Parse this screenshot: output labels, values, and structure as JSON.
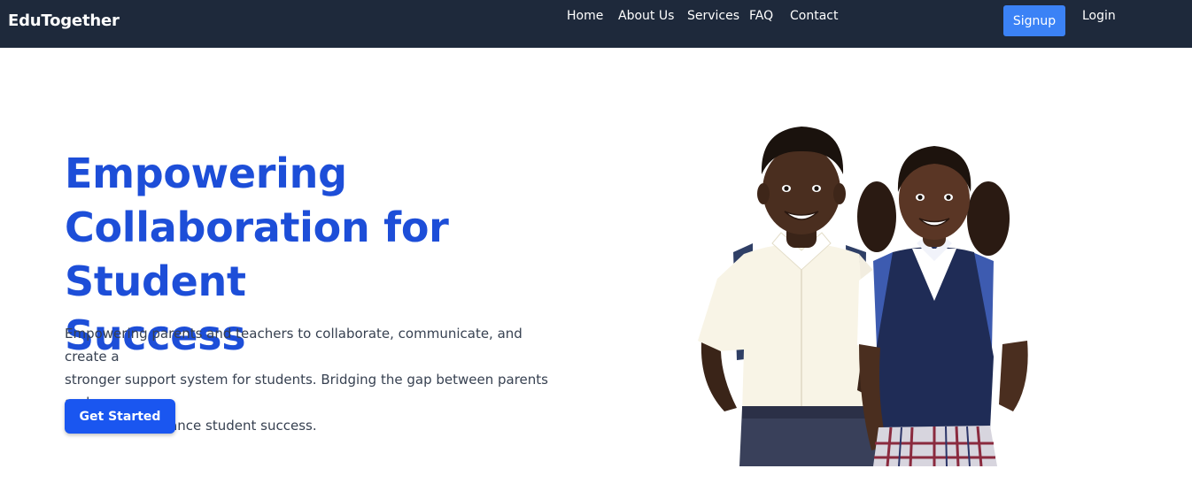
{
  "nav": {
    "brand": "EduTogether",
    "links": [
      "Home",
      "About Us",
      "Services",
      "FAQ",
      "Contact"
    ],
    "signup": "Signup",
    "login": "Login"
  },
  "hero": {
    "title_lines": [
      "Empowering",
      "Collaboration for Student",
      "Success"
    ],
    "description_lines": [
      "Empowering parents and teachers to collaborate, communicate, and create a",
      "stronger support system for students. Bridging the gap between parents and",
      "teachers to enhance student success."
    ],
    "cta": "Get Started"
  },
  "colors": {
    "nav_bg": "#1e293b",
    "title": "#1d4ed8",
    "signup_bg": "#3b82f6",
    "cta_bg": "#1a56f0"
  }
}
